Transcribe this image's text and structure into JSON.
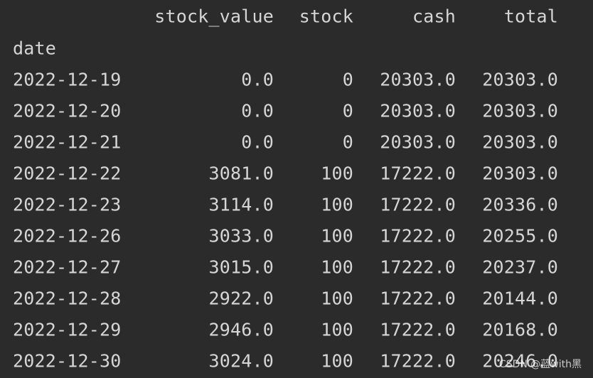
{
  "table": {
    "columns": [
      "stock_value",
      "stock",
      "cash",
      "total"
    ],
    "index_name": "date",
    "rows": [
      {
        "date": "2022-12-19",
        "stock_value": "0.0",
        "stock": "0",
        "cash": "20303.0",
        "total": "20303.0"
      },
      {
        "date": "2022-12-20",
        "stock_value": "0.0",
        "stock": "0",
        "cash": "20303.0",
        "total": "20303.0"
      },
      {
        "date": "2022-12-21",
        "stock_value": "0.0",
        "stock": "0",
        "cash": "20303.0",
        "total": "20303.0"
      },
      {
        "date": "2022-12-22",
        "stock_value": "3081.0",
        "stock": "100",
        "cash": "17222.0",
        "total": "20303.0"
      },
      {
        "date": "2022-12-23",
        "stock_value": "3114.0",
        "stock": "100",
        "cash": "17222.0",
        "total": "20336.0"
      },
      {
        "date": "2022-12-26",
        "stock_value": "3033.0",
        "stock": "100",
        "cash": "17222.0",
        "total": "20255.0"
      },
      {
        "date": "2022-12-27",
        "stock_value": "3015.0",
        "stock": "100",
        "cash": "17222.0",
        "total": "20237.0"
      },
      {
        "date": "2022-12-28",
        "stock_value": "2922.0",
        "stock": "100",
        "cash": "17222.0",
        "total": "20144.0"
      },
      {
        "date": "2022-12-29",
        "stock_value": "2946.0",
        "stock": "100",
        "cash": "17222.0",
        "total": "20168.0"
      },
      {
        "date": "2022-12-30",
        "stock_value": "3024.0",
        "stock": "100",
        "cash": "17222.0",
        "total": "20246.0"
      }
    ]
  },
  "watermark": "CSDN @蓝with黑",
  "colors": {
    "background": "#2b2b2b",
    "text": "#d6d6d6"
  }
}
